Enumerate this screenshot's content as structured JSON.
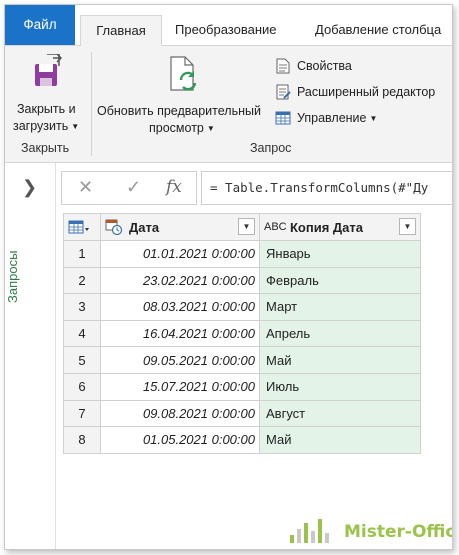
{
  "tabs": {
    "file": "Файл",
    "home": "Главная",
    "transform": "Преобразование",
    "add_column": "Добавление столбца"
  },
  "ribbon": {
    "close_load_line1": "Закрыть и",
    "close_load_line2": "загрузить",
    "refresh_line1": "Обновить предварительный",
    "refresh_line2": "просмотр",
    "properties": "Свойства",
    "advanced_editor": "Расширенный редактор",
    "manage": "Управление",
    "group_close": "Закрыть",
    "group_query": "Запрос"
  },
  "queries_pane": {
    "label": "Запросы"
  },
  "formula_bar": {
    "formula": "= Table.TransformColumns(#\"Ду"
  },
  "table": {
    "columns": [
      "Дата",
      "Копия Дата"
    ],
    "col2_type": "ABC",
    "rows": [
      {
        "idx": "1",
        "date": "01.01.2021 0:00:00",
        "copy": "Январь"
      },
      {
        "idx": "2",
        "date": "23.02.2021 0:00:00",
        "copy": "Февраль"
      },
      {
        "idx": "3",
        "date": "08.03.2021 0:00:00",
        "copy": "Март"
      },
      {
        "idx": "4",
        "date": "16.04.2021 0:00:00",
        "copy": "Апрель"
      },
      {
        "idx": "5",
        "date": "09.05.2021 0:00:00",
        "copy": "Май"
      },
      {
        "idx": "6",
        "date": "15.07.2021 0:00:00",
        "copy": "Июль"
      },
      {
        "idx": "7",
        "date": "09.08.2021 0:00:00",
        "copy": "Август"
      },
      {
        "idx": "8",
        "date": "01.05.2021 0:00:00",
        "copy": "Май"
      }
    ]
  },
  "watermark": "Mister-Office",
  "colors": {
    "file_tab": "#1b73c9",
    "queries_label": "#2e7d45",
    "copy_column_bg": "#e3f3e8",
    "watermark": "#9bc24a"
  }
}
